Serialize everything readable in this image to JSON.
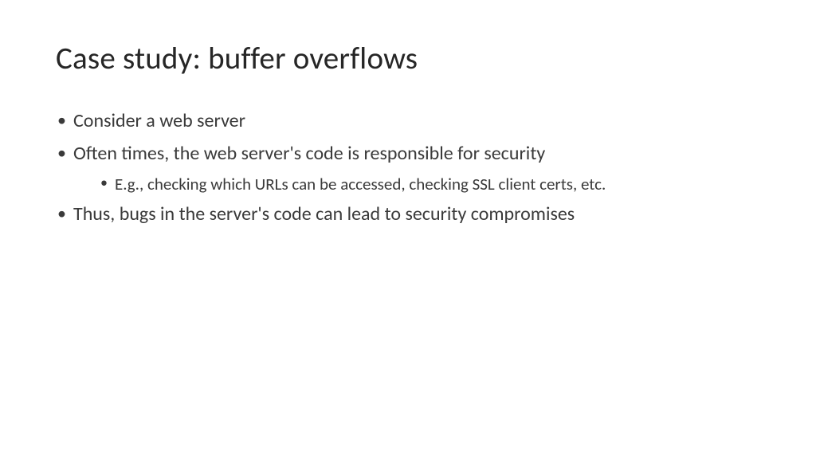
{
  "title": "Case study: buffer overflows",
  "bullets": [
    {
      "text": "Consider a web server",
      "children": []
    },
    {
      "text": "Often times, the web server's code is responsible for security",
      "children": [
        "E.g., checking which URLs can be accessed, checking SSL client certs, etc."
      ]
    },
    {
      "text": "Thus, bugs in the server's code can lead to security compromises",
      "children": []
    }
  ]
}
